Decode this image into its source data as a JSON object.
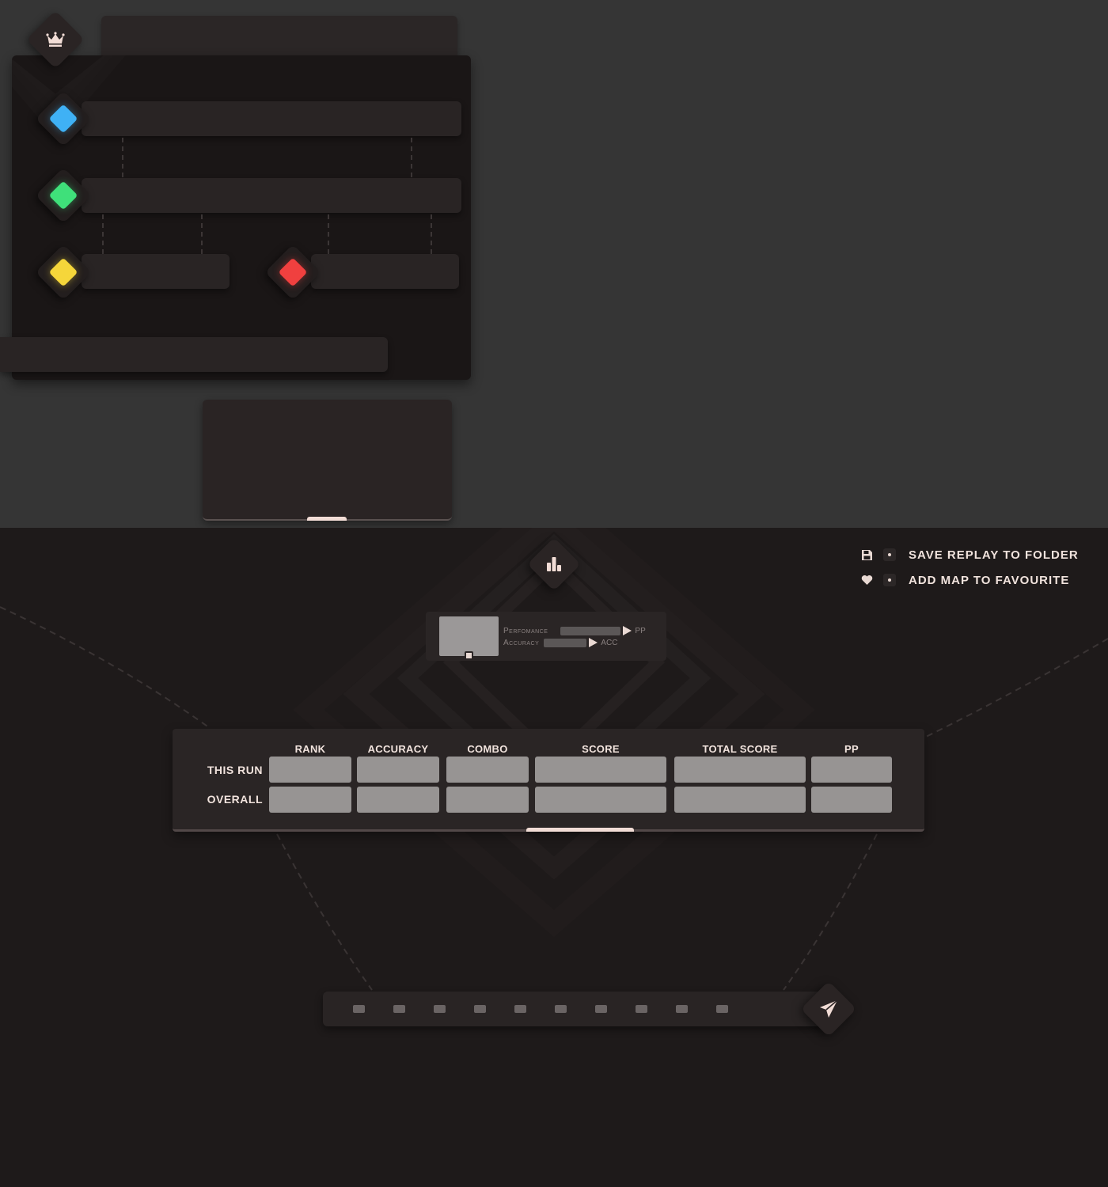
{
  "icons": {
    "crown": "crown-icon",
    "stats": "bar-chart-icon",
    "save": "floppy-disk-icon",
    "favourite": "heart-icon",
    "send": "paper-plane-icon",
    "lock": "lock-icon"
  },
  "colors": {
    "mod_blue": "#3fb1f5",
    "mod_green": "#3fe07a",
    "mod_yellow": "#f5d63a",
    "mod_red": "#f0403f",
    "accent": "#f2ddd6"
  },
  "actions": {
    "save_label": "SAVE REPLAY TO FOLDER",
    "favourite_label": "ADD MAP TO FAVOURITE"
  },
  "performance": {
    "perf_label": "Perfomance",
    "perf_unit": "PP",
    "acc_label": "Accuracy",
    "acc_unit": "ACC"
  },
  "scores": {
    "columns": [
      "RANK",
      "ACCURACY",
      "COMBO",
      "SCORE",
      "TOTAL SCORE",
      "PP"
    ],
    "rows": [
      "THIS RUN",
      "OVERALL"
    ]
  },
  "pager": {
    "page_count": 10
  }
}
